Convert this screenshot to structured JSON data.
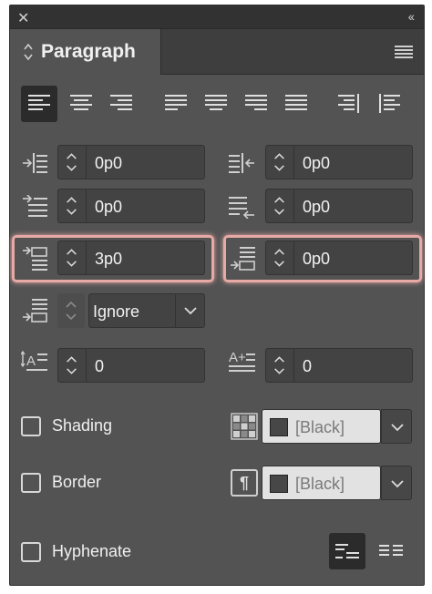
{
  "title_bar": {
    "close_glyph": "✕",
    "collapse_glyph": "‹‹"
  },
  "panel": {
    "title": "Paragraph"
  },
  "alignment": {
    "buttons": [
      {
        "name": "align-left",
        "active": true
      },
      {
        "name": "align-center",
        "active": false
      },
      {
        "name": "align-right",
        "active": false
      },
      {
        "name": "justify-left",
        "active": false
      },
      {
        "name": "justify-center",
        "active": false
      },
      {
        "name": "justify-right",
        "active": false
      },
      {
        "name": "justify-all",
        "active": false
      },
      {
        "name": "align-towards-spine",
        "active": false
      },
      {
        "name": "align-away-from-spine",
        "active": false
      }
    ]
  },
  "fields": {
    "left_indent": "0p0",
    "right_indent": "0p0",
    "first_line_indent": "0p0",
    "last_line_right_indent": "0p0",
    "space_before": "3p0",
    "space_after": "0p0",
    "align_to_grid": "Ignore",
    "drop_cap_lines": "0",
    "drop_cap_chars": "0"
  },
  "options": {
    "shading_label": "Shading",
    "shading_color": "[Black]",
    "border_label": "Border",
    "border_color": "[Black]",
    "hyphenate_label": "Hyphenate",
    "pilcrow_glyph": "¶"
  },
  "colors": {
    "highlight": "#e6a9a6",
    "panel_bg": "#535353",
    "field_bg": "#434343"
  }
}
